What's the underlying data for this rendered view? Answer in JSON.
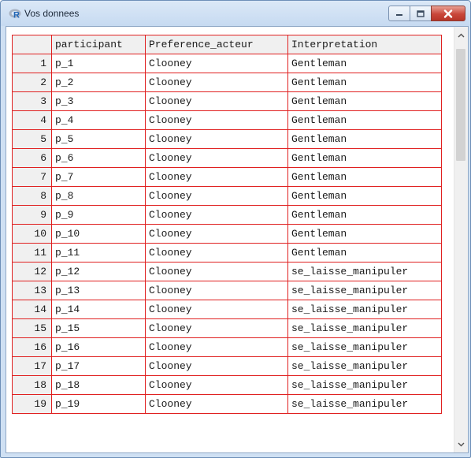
{
  "window": {
    "title": "Vos donnees"
  },
  "columns": [
    "participant",
    "Preference_acteur",
    "Interpretation"
  ],
  "rows": [
    {
      "index": "1",
      "participant": "p_1",
      "preference": "Clooney",
      "interpretation": "Gentleman"
    },
    {
      "index": "2",
      "participant": "p_2",
      "preference": "Clooney",
      "interpretation": "Gentleman"
    },
    {
      "index": "3",
      "participant": "p_3",
      "preference": "Clooney",
      "interpretation": "Gentleman"
    },
    {
      "index": "4",
      "participant": "p_4",
      "preference": "Clooney",
      "interpretation": "Gentleman"
    },
    {
      "index": "5",
      "participant": "p_5",
      "preference": "Clooney",
      "interpretation": "Gentleman"
    },
    {
      "index": "6",
      "participant": "p_6",
      "preference": "Clooney",
      "interpretation": "Gentleman"
    },
    {
      "index": "7",
      "participant": "p_7",
      "preference": "Clooney",
      "interpretation": "Gentleman"
    },
    {
      "index": "8",
      "participant": "p_8",
      "preference": "Clooney",
      "interpretation": "Gentleman"
    },
    {
      "index": "9",
      "participant": "p_9",
      "preference": "Clooney",
      "interpretation": "Gentleman"
    },
    {
      "index": "10",
      "participant": "p_10",
      "preference": "Clooney",
      "interpretation": "Gentleman"
    },
    {
      "index": "11",
      "participant": "p_11",
      "preference": "Clooney",
      "interpretation": "Gentleman"
    },
    {
      "index": "12",
      "participant": "p_12",
      "preference": "Clooney",
      "interpretation": "se_laisse_manipuler"
    },
    {
      "index": "13",
      "participant": "p_13",
      "preference": "Clooney",
      "interpretation": "se_laisse_manipuler"
    },
    {
      "index": "14",
      "participant": "p_14",
      "preference": "Clooney",
      "interpretation": "se_laisse_manipuler"
    },
    {
      "index": "15",
      "participant": "p_15",
      "preference": "Clooney",
      "interpretation": "se_laisse_manipuler"
    },
    {
      "index": "16",
      "participant": "p_16",
      "preference": "Clooney",
      "interpretation": "se_laisse_manipuler"
    },
    {
      "index": "17",
      "participant": "p_17",
      "preference": "Clooney",
      "interpretation": "se_laisse_manipuler"
    },
    {
      "index": "18",
      "participant": "p_18",
      "preference": "Clooney",
      "interpretation": "se_laisse_manipuler"
    },
    {
      "index": "19",
      "participant": "p_19",
      "preference": "Clooney",
      "interpretation": "se_laisse_manipuler"
    }
  ],
  "icons": {
    "app": "r-logo-icon",
    "minimize": "minimize-icon",
    "maximize": "maximize-icon",
    "close": "close-icon",
    "scroll_up": "chevron-up-icon",
    "scroll_down": "chevron-down-icon"
  },
  "colors": {
    "grid_border": "#e02020",
    "header_bg": "#f0f0f0",
    "close_button": "#c9463a"
  }
}
